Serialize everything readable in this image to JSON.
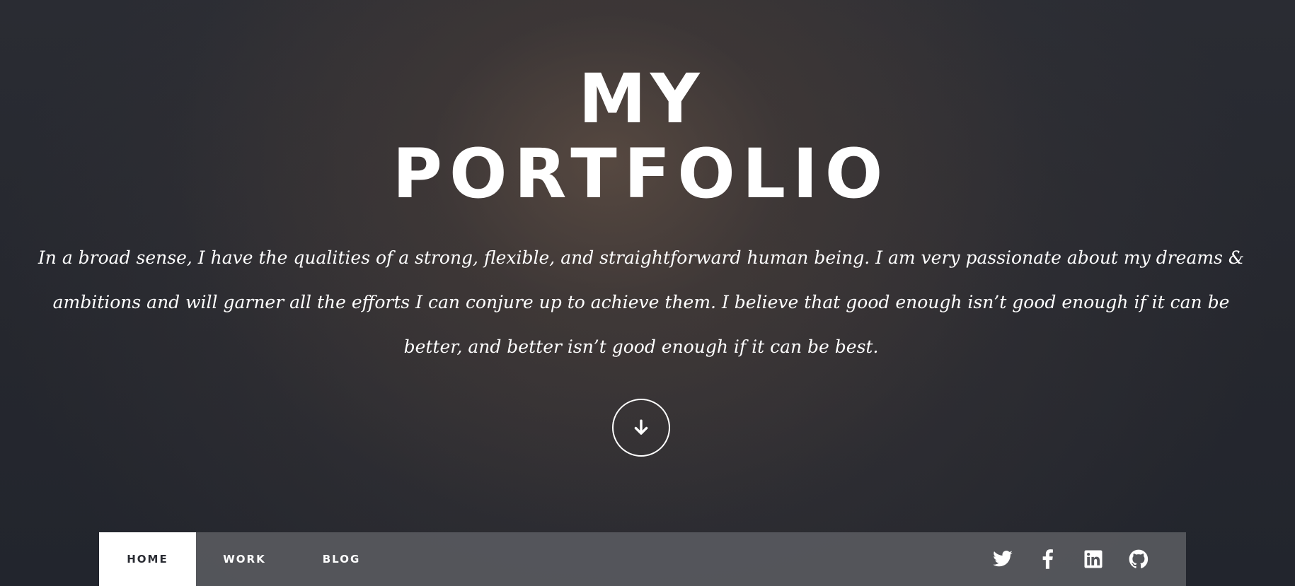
{
  "hero": {
    "title_line_1": "MY",
    "title_line_2": "PORTFOLIO",
    "intro": "In a broad sense, I have the qualities of a strong, flexible, and straightforward human being. I am very passionate about my dreams & ambitions and will garner all the efforts I can conjure up to achieve them. I believe that good enough isn’t good enough if it can be better, and better isn’t good enough if it can be best.",
    "scroll_icon": "arrow-down-icon"
  },
  "nav": {
    "items": [
      {
        "label": "HOME",
        "active": true
      },
      {
        "label": "WORK",
        "active": false
      },
      {
        "label": "BLOG",
        "active": false
      }
    ],
    "social": [
      "twitter-icon",
      "facebook-icon",
      "linkedin-icon",
      "github-icon"
    ]
  },
  "colors": {
    "text": "#ffffff",
    "nav_background": "#58595e",
    "nav_active_background": "#ffffff",
    "nav_active_text": "#2a2c33"
  }
}
